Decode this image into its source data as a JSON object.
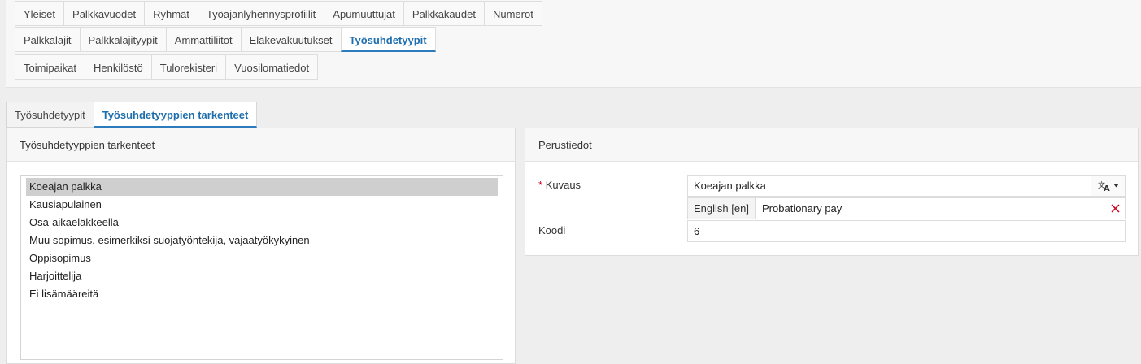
{
  "nav": {
    "row1": [
      "Yleiset",
      "Palkkavuodet",
      "Ryhmät",
      "Työajanlyhennysprofiilit",
      "Apumuuttujat",
      "Palkkakaudet",
      "Numerot"
    ],
    "row2": [
      "Palkkalajit",
      "Palkkalajityypit",
      "Ammattiliitot",
      "Eläkevakuutukset",
      "Työsuhdetyypit"
    ],
    "row3": [
      "Toimipaikat",
      "Henkilöstö",
      "Tulorekisteri",
      "Vuosilomatiedot"
    ],
    "active": "Työsuhdetyypit"
  },
  "subtabs": {
    "items": [
      "Työsuhdetyypit",
      "Työsuhdetyyppien tarkenteet"
    ],
    "active": "Työsuhdetyyppien tarkenteet"
  },
  "left_panel": {
    "title": "Työsuhdetyyppien tarkenteet",
    "items": [
      "Koeajan palkka",
      "Kausiapulainen",
      "Osa-aikaeläkkeellä",
      "Muu sopimus, esimerkiksi suojatyöntekija, vajaatyökykyinen",
      "Oppisopimus",
      "Harjoittelija",
      "Ei lisämääreitä"
    ],
    "selected_index": 0
  },
  "right_panel": {
    "title": "Perustiedot",
    "kuvaus_label": "Kuvaus",
    "required_mark": "*",
    "kuvaus_value": "Koeajan palkka",
    "translation_lang": "English [en]",
    "translation_value": "Probationary pay",
    "koodi_label": "Koodi",
    "koodi_value": "6"
  },
  "colors": {
    "accent": "#1f6fae",
    "required": "#d0021b",
    "remove": "#d0021b",
    "selected_row": "#cfcfcf"
  },
  "icons": {
    "translate": "translate-icon",
    "dropdown": "caret-down-icon",
    "remove": "close-icon"
  }
}
